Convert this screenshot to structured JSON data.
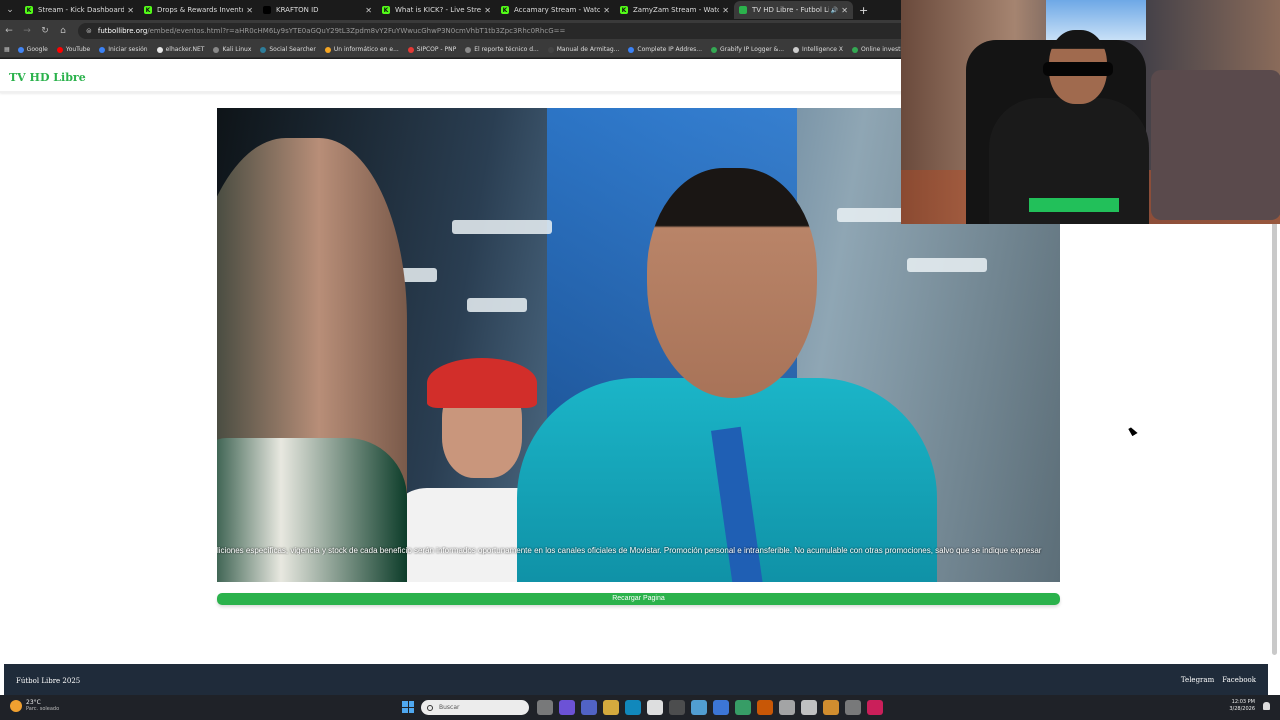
{
  "browser": {
    "tabs": [
      {
        "title": "Stream - Kick Dashboard",
        "favicon_color": "#53fc18",
        "favicon": "K",
        "active": false
      },
      {
        "title": "Drops & Rewards Inventory - K",
        "favicon_color": "#53fc18",
        "favicon": "K",
        "active": false
      },
      {
        "title": "KRAFTON ID",
        "favicon_color": "#000000",
        "favicon": "",
        "active": false
      },
      {
        "title": "What is KICK? - Live Stream & V",
        "favicon_color": "#53fc18",
        "favicon": "K",
        "active": false
      },
      {
        "title": "Accamary Stream - Watch Live",
        "favicon_color": "#53fc18",
        "favicon": "K",
        "active": false
      },
      {
        "title": "ZamyZam Stream - Watch Live",
        "favicon_color": "#53fc18",
        "favicon": "K",
        "active": false
      },
      {
        "title": "TV HD Libre - Futbol Libre",
        "favicon_color": "#2bb24c",
        "favicon": "",
        "active": true
      }
    ],
    "address": {
      "host": "futbollibre.org",
      "path": "/embed/eventos.html?r=aHR0cHM6Ly9sYTE0aGQuY29tL3Zpdm8vY2FuYWwucGhwP3N0cmVhbT1tb3Zpc3Rhc0RhcG=="
    },
    "bookmarks": [
      {
        "label": "Google",
        "color": "#4285f4"
      },
      {
        "label": "YouTube",
        "color": "#ff0000"
      },
      {
        "label": "Iniciar sesión",
        "color": "#3b82f6"
      },
      {
        "label": "elhacker.NET",
        "color": "#e5e5e5"
      },
      {
        "label": "Kali Linux",
        "color": "#888888"
      },
      {
        "label": "Social Searcher",
        "color": "#2d7d9a"
      },
      {
        "label": "Un informático en e...",
        "color": "#f5a623"
      },
      {
        "label": "SIPCOP - PNP",
        "color": "#e53935"
      },
      {
        "label": "El reporte técnico d...",
        "color": "#888888"
      },
      {
        "label": "Manual de Armitag...",
        "color": "#444444"
      },
      {
        "label": "Complete IP Addres...",
        "color": "#3b82f6"
      },
      {
        "label": "Grabify IP Logger &...",
        "color": "#34a853"
      },
      {
        "label": "Intelligence X",
        "color": "#cccccc"
      },
      {
        "label": "Online investigation...",
        "color": "#34a853"
      }
    ]
  },
  "site": {
    "brand": "TV HD Libre",
    "subtitle_text": "liciones específicas, vigencia y stock de cada beneficio serán informados oportunamente en los canales oficiales de Movistar. Promoción personal e intransferible. No acumulable con otras promociones, salvo que se indique expresar",
    "reload_label": "Recargar Pagina",
    "footer_copy": "Fútbol Libre 2025",
    "footer_links": [
      "Telegram",
      "Facebook"
    ]
  },
  "taskbar": {
    "weather_temp": "23°C",
    "weather_desc": "Parc. soleado",
    "search_placeholder": "Buscar",
    "time": "12:03 PM",
    "date": "3/28/2026",
    "icon_colors": [
      "#888888",
      "#7a5af5",
      "#5b6ee1",
      "#f5c242",
      "#0f9ad6",
      "#ffffff",
      "#555555",
      "#5ab4f0",
      "#4285f4",
      "#3cb371",
      "#e66000",
      "#bbbbbb",
      "#dddddd",
      "#f0a030",
      "#888888",
      "#e91e63"
    ]
  },
  "colors": {
    "brand_green": "#2bb24c",
    "footer_bg": "#1f2b3a"
  }
}
